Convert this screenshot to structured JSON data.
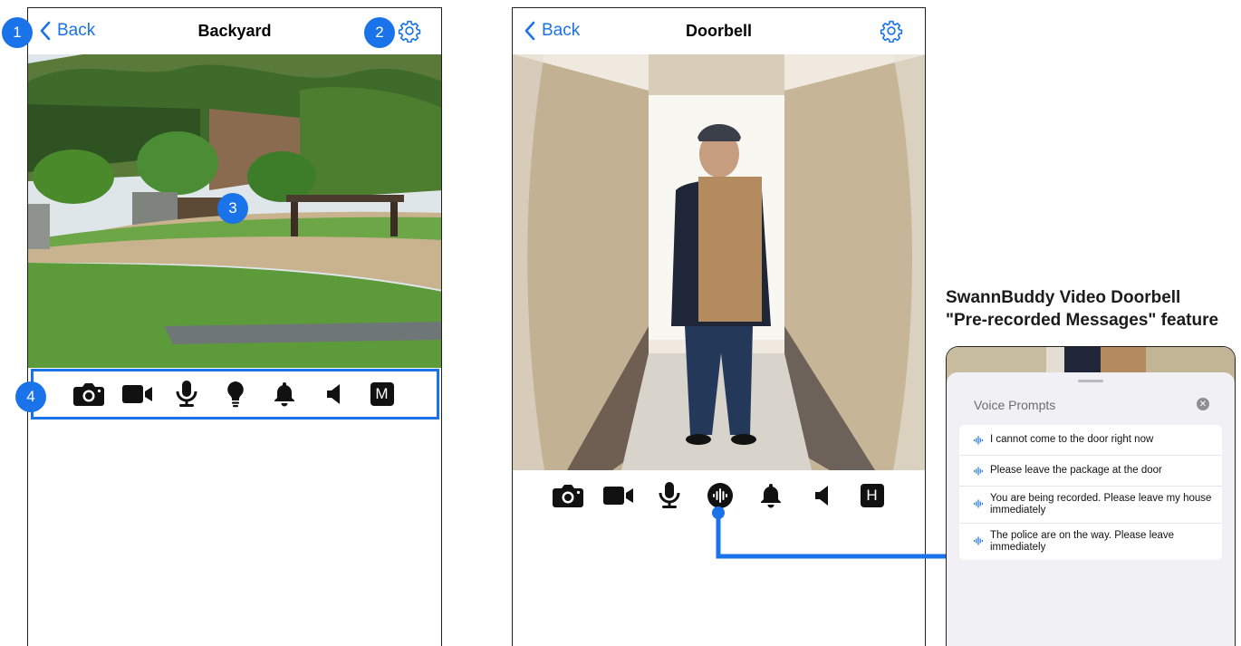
{
  "colors": {
    "accent": "#1a73e8",
    "icon": "#111111"
  },
  "left_screen": {
    "back_label": "Back",
    "title": "Backyard",
    "toolbar": [
      "camera-icon",
      "video-record-icon",
      "microphone-icon",
      "light-bulb-icon",
      "bell-icon",
      "speaker-icon",
      "M"
    ],
    "badges": [
      "1",
      "2",
      "3",
      "4"
    ]
  },
  "right_screen": {
    "back_label": "Back",
    "title": "Doorbell",
    "toolbar": [
      "camera-icon",
      "video-record-icon",
      "microphone-icon",
      "voice-prompts-icon",
      "bell-icon",
      "speaker-icon",
      "H"
    ]
  },
  "callout": {
    "title_line1": "SwannBuddy Video Doorbell",
    "title_line2": "\"Pre-recorded Messages\" feature"
  },
  "voice_prompts": {
    "title": "Voice Prompts",
    "items": [
      "I cannot come to the door right now",
      "Please leave the package at the door",
      "You are being recorded. Please leave my house immediately",
      "The police are on the way. Please leave immediately"
    ]
  }
}
